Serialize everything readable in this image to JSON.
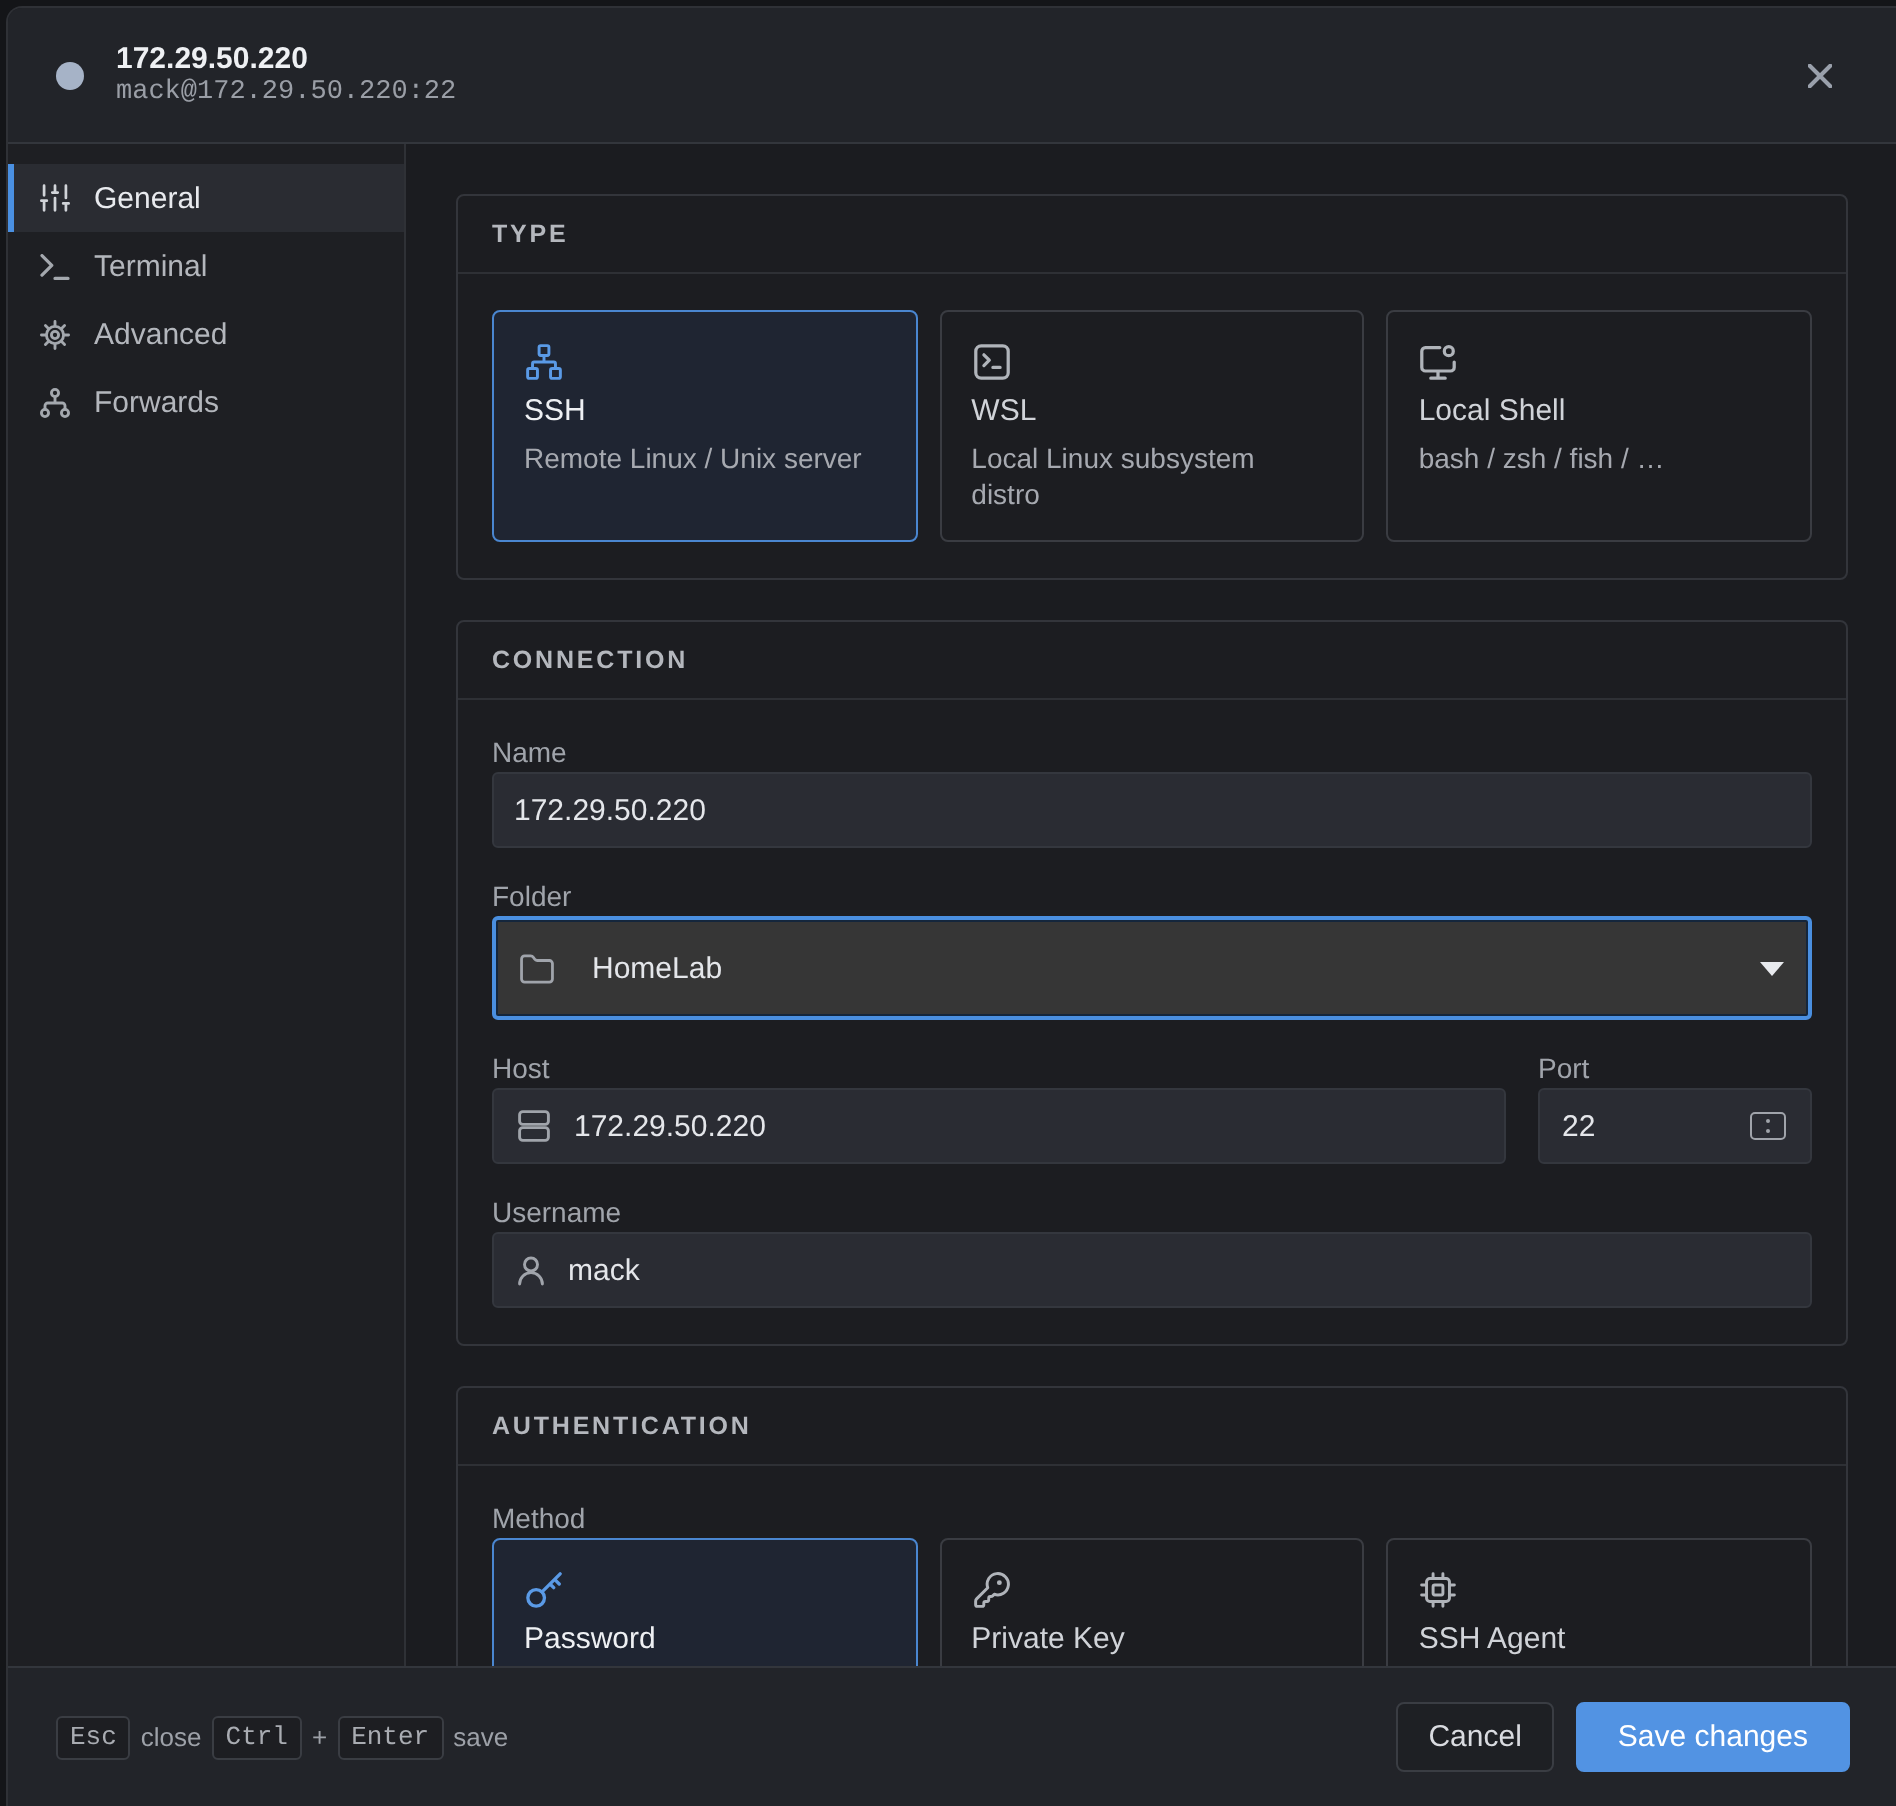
{
  "header": {
    "title": "172.29.50.220",
    "subtitle": "mack@172.29.50.220:22"
  },
  "sidebar": {
    "items": [
      {
        "label": "General",
        "selected": true
      },
      {
        "label": "Terminal",
        "selected": false
      },
      {
        "label": "Advanced",
        "selected": false
      },
      {
        "label": "Forwards",
        "selected": false
      }
    ]
  },
  "sections": [
    {
      "title": "TYPE",
      "kind": "options",
      "options": [
        {
          "title": "SSH",
          "description": "Remote Linux / Unix server",
          "selected": true
        },
        {
          "title": "WSL",
          "description": "Local Linux subsystem distro",
          "selected": false
        },
        {
          "title": "Local Shell",
          "description": "bash / zsh / fish / …",
          "selected": false
        }
      ]
    },
    {
      "title": "CONNECTION",
      "kind": "fields",
      "rows": [
        [
          {
            "label": "Name",
            "kind": "text",
            "value": "172.29.50.220",
            "focused": false
          }
        ],
        [
          {
            "label": "Folder",
            "kind": "select",
            "value": "HomeLab",
            "focused": true
          }
        ],
        [
          {
            "label": "Host",
            "kind": "text",
            "value": "172.29.50.220",
            "focused": false
          },
          {
            "label": "Port",
            "kind": "number",
            "value": "22",
            "focused": false
          }
        ],
        [
          {
            "label": "Username",
            "kind": "text",
            "value": "mack",
            "focused": false
          }
        ]
      ]
    },
    {
      "title": "AUTHENTICATION",
      "kind": "options",
      "label": "Method",
      "options": [
        {
          "title": "Password",
          "selected": true
        },
        {
          "title": "Private Key",
          "selected": false
        },
        {
          "title": "SSH Agent",
          "selected": false
        }
      ]
    }
  ],
  "footer": {
    "hints": [
      {
        "kind": "key",
        "text": "Esc"
      },
      {
        "kind": "text",
        "text": "close"
      },
      {
        "kind": "key",
        "text": "Ctrl"
      },
      {
        "kind": "separator",
        "text": "+"
      },
      {
        "kind": "key",
        "text": "Enter"
      },
      {
        "kind": "text",
        "text": "save"
      }
    ],
    "buttons": [
      {
        "label": "Cancel",
        "kind": "secondary"
      },
      {
        "label": "Save changes",
        "kind": "primary"
      }
    ]
  }
}
